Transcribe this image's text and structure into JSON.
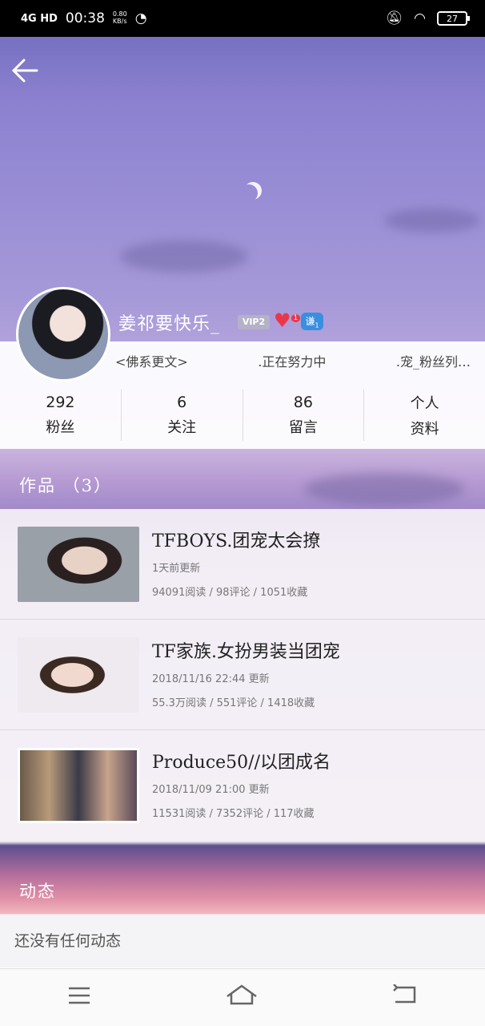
{
  "status_bar": {
    "network": "4G HD",
    "time": "00:38",
    "speed_value": "0.80",
    "speed_unit": "KB/s",
    "battery": "27"
  },
  "profile": {
    "username": "姜祁要快乐_",
    "vip_label": "VIP2",
    "heart_badge_count": "1",
    "medal_label": "谦",
    "medal_count": "1",
    "tagline_parts": [
      "<佛系更文>",
      ".正在努力中",
      ".宠_粉丝列…"
    ]
  },
  "stats": [
    {
      "value": "292",
      "label": "粉丝"
    },
    {
      "value": "6",
      "label": "关注"
    },
    {
      "value": "86",
      "label": "留言"
    },
    {
      "value": "个人",
      "label": "资料"
    }
  ],
  "works": {
    "title": "作品  （3）",
    "items": [
      {
        "title": "TFBOYS.团宠太会撩",
        "updated": "1天前更新",
        "meta": "94091阅读 / 98评论 / 1051收藏"
      },
      {
        "title": "TF家族.女扮男装当团宠",
        "updated": "2018/11/16  22:44 更新",
        "meta": "55.3万阅读 / 551评论 / 1418收藏"
      },
      {
        "title": "Produce50//以团成名",
        "updated": "2018/11/09  21:00 更新",
        "meta": "11531阅读 / 7352评论 / 117收藏"
      }
    ]
  },
  "dynamics": {
    "title": "动态",
    "empty_text": "还没有任何动态"
  },
  "icons": {
    "back": "arrow-left-icon",
    "menu": "menu-icon",
    "home": "home-icon",
    "return": "return-icon"
  }
}
